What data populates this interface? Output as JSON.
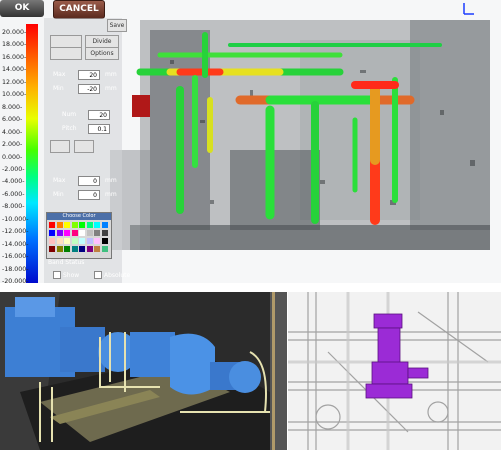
{
  "toolbar": {
    "ok_label": "OK",
    "cancel_label": "CANCEL",
    "save_label": "Save"
  },
  "legend": {
    "ticks": [
      "20.000-",
      "18.000-",
      "16.000-",
      "14.000-",
      "12.000-",
      "10.000-",
      "8.000-",
      "6.000-",
      "4.000-",
      "2.000-",
      "0.000-",
      "-2.000-",
      "-4.000-",
      "-6.000-",
      "-8.000-",
      "-10.000-",
      "-12.000-",
      "-14.000-",
      "-16.000-",
      "-18.000-",
      "-20.000-"
    ]
  },
  "panel": {
    "top_buttons": [
      "Divide",
      "Options"
    ],
    "max_label": "Max",
    "min_label": "Min",
    "max_value": "20",
    "min_value": "-20",
    "unit": "mm",
    "num_label": "Num",
    "num_value": "20",
    "pitch_label": "Pitch",
    "pitch_value": "0.1",
    "max2_value": "0",
    "min2_value": "0",
    "chooser_title": "Choose Color",
    "band_status_label": "Band Status",
    "show_label": "Show",
    "absolute_label": "Absolute"
  },
  "colors": {
    "ok_button": "#444444",
    "cancel_button": "#7a3b2b",
    "pipe_gradient": "green-yellow-red",
    "purple_pump": "#9b2bd6",
    "blue_machine": "#4a90e8"
  }
}
